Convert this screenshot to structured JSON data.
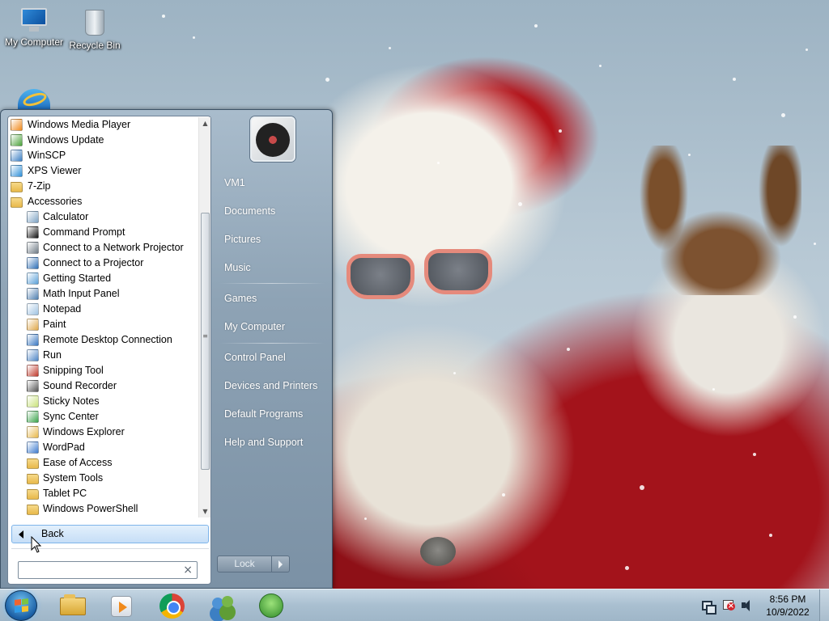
{
  "desktop": {
    "icons": [
      {
        "label": "My Computer",
        "icon": "computer-icon"
      },
      {
        "label": "Recycle Bin",
        "icon": "recycle-bin-icon"
      }
    ],
    "partial_icon": "internet-explorer-icon",
    "wallpaper": "santa-sunglasses-wallpaper"
  },
  "start_menu": {
    "programs": [
      {
        "label": "Windows Media Player",
        "icon": "media-player-icon",
        "level": 0,
        "color": "#f08a1c"
      },
      {
        "label": "Windows Update",
        "icon": "windows-update-icon",
        "level": 0,
        "color": "#4aa23a"
      },
      {
        "label": "WinSCP",
        "icon": "winscp-icon",
        "level": 0,
        "color": "#3b7fc4"
      },
      {
        "label": "XPS Viewer",
        "icon": "xps-viewer-icon",
        "level": 0,
        "color": "#2e8fd8"
      },
      {
        "label": "7-Zip",
        "icon": "folder-icon",
        "level": 0,
        "color": "#e8b84a"
      },
      {
        "label": "Accessories",
        "icon": "folder-icon",
        "level": 0,
        "color": "#e8b84a"
      },
      {
        "label": "Calculator",
        "icon": "calculator-icon",
        "level": 1,
        "color": "#7ea3c4"
      },
      {
        "label": "Command Prompt",
        "icon": "command-prompt-icon",
        "level": 1,
        "color": "#111111"
      },
      {
        "label": "Connect to a Network Projector",
        "icon": "network-projector-icon",
        "level": 1,
        "color": "#6f7b86"
      },
      {
        "label": "Connect to a Projector",
        "icon": "projector-icon",
        "level": 1,
        "color": "#2f6fb6"
      },
      {
        "label": "Getting Started",
        "icon": "getting-started-icon",
        "level": 1,
        "color": "#5aa0d8"
      },
      {
        "label": "Math Input Panel",
        "icon": "math-input-icon",
        "level": 1,
        "color": "#4f7fb0"
      },
      {
        "label": "Notepad",
        "icon": "notepad-icon",
        "level": 1,
        "color": "#9fc3e2"
      },
      {
        "label": "Paint",
        "icon": "paint-icon",
        "level": 1,
        "color": "#e0a84a"
      },
      {
        "label": "Remote Desktop Connection",
        "icon": "remote-desktop-icon",
        "level": 1,
        "color": "#3a78c2"
      },
      {
        "label": "Run",
        "icon": "run-icon",
        "level": 1,
        "color": "#4f86c6"
      },
      {
        "label": "Snipping Tool",
        "icon": "scissors-icon",
        "level": 1,
        "color": "#c0392b"
      },
      {
        "label": "Sound Recorder",
        "icon": "microphone-icon",
        "level": 1,
        "color": "#555555"
      },
      {
        "label": "Sticky Notes",
        "icon": "sticky-notes-icon",
        "level": 1,
        "color": "#c9e27a"
      },
      {
        "label": "Sync Center",
        "icon": "sync-center-icon",
        "level": 1,
        "color": "#3aa34a"
      },
      {
        "label": "Windows Explorer",
        "icon": "explorer-icon",
        "level": 1,
        "color": "#e8b84a"
      },
      {
        "label": "WordPad",
        "icon": "wordpad-icon",
        "level": 1,
        "color": "#3f7ccf"
      },
      {
        "label": "Ease of Access",
        "icon": "folder-icon",
        "level": 1,
        "color": "#e8b84a"
      },
      {
        "label": "System Tools",
        "icon": "folder-icon",
        "level": 1,
        "color": "#e8b84a"
      },
      {
        "label": "Tablet PC",
        "icon": "folder-icon",
        "level": 1,
        "color": "#e8b84a"
      },
      {
        "label": "Windows PowerShell",
        "icon": "folder-icon",
        "level": 1,
        "color": "#e8b84a"
      }
    ],
    "back_label": "Back",
    "search": {
      "value": "",
      "placeholder": ""
    },
    "user_picture": "turntable-user-picture",
    "right_items": [
      {
        "label": "VM1",
        "name": "right-item-user-folder"
      },
      {
        "label": "Documents",
        "name": "right-item-documents"
      },
      {
        "label": "Pictures",
        "name": "right-item-pictures"
      },
      {
        "label": "Music",
        "name": "right-item-music"
      },
      {
        "label": "Games",
        "name": "right-item-games"
      },
      {
        "label": "My Computer",
        "name": "right-item-my-computer"
      },
      {
        "label": "Control Panel",
        "name": "right-item-control-panel"
      },
      {
        "label": "Devices and Printers",
        "name": "right-item-devices-printers"
      },
      {
        "label": "Default Programs",
        "name": "right-item-default-programs"
      },
      {
        "label": "Help and Support",
        "name": "right-item-help-support"
      }
    ],
    "lock_label": "Lock"
  },
  "taskbar": {
    "pinned": [
      {
        "name": "windows-explorer-taskbar-icon"
      },
      {
        "name": "media-player-taskbar-icon"
      },
      {
        "name": "chrome-taskbar-icon"
      },
      {
        "name": "people-taskbar-icon"
      },
      {
        "name": "windows-update-taskbar-icon"
      }
    ],
    "tray": {
      "icons": [
        "network-icon",
        "action-center-flag-icon",
        "volume-icon"
      ],
      "time": "8:56 PM",
      "date": "10/9/2022"
    }
  }
}
